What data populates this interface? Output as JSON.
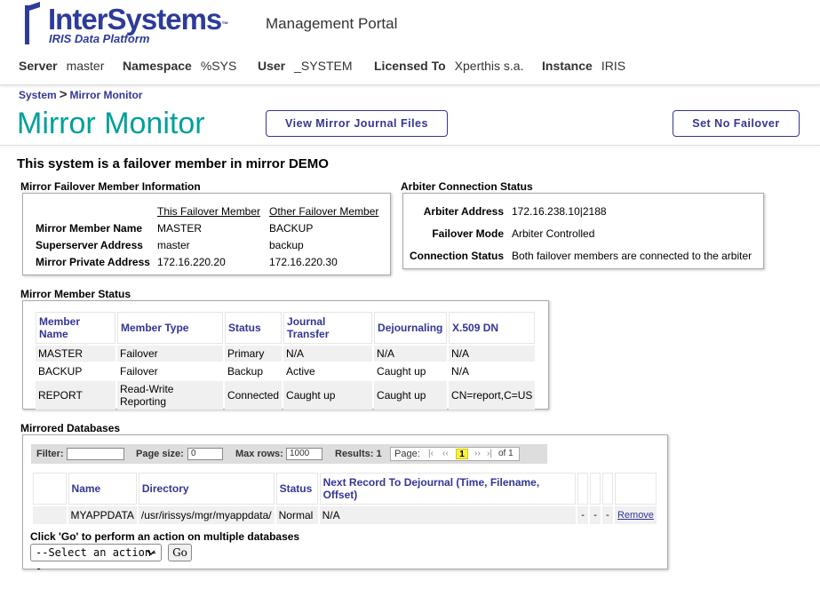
{
  "header": {
    "logo": {
      "brand": "InterSystems",
      "tm": "™",
      "product": "IRIS Data Platform"
    },
    "portal_title": "Management Portal",
    "context": {
      "server_label": "Server",
      "server": "master",
      "namespace_label": "Namespace",
      "namespace": "%SYS",
      "user_label": "User",
      "user": "_SYSTEM",
      "licensed_label": "Licensed To",
      "licensed": "Xperthis s.a.",
      "instance_label": "Instance",
      "instance": "IRIS"
    }
  },
  "breadcrumb": {
    "root": "System",
    "sep": ">",
    "current": "Mirror Monitor"
  },
  "page_title": "Mirror Monitor",
  "buttons": {
    "journal": "View Mirror Journal Files",
    "failover": "Set No Failover"
  },
  "headline": "This system is a failover member in mirror DEMO",
  "member_info": {
    "section": "Mirror Failover Member Information",
    "col_this": "This Failover Member",
    "col_other": "Other Failover Member",
    "rows": [
      {
        "label": "Mirror Member Name",
        "this": "MASTER",
        "other": "BACKUP"
      },
      {
        "label": "Superserver Address",
        "this": "master",
        "other": "backup"
      },
      {
        "label": "Mirror Private Address",
        "this": "172.16.220.20",
        "other": "172.16.220.30"
      }
    ]
  },
  "arbiter": {
    "section": "Arbiter Connection Status",
    "rows": [
      {
        "label": "Arbiter Address",
        "value": "172.16.238.10|2188"
      },
      {
        "label": "Failover Mode",
        "value": "Arbiter Controlled"
      },
      {
        "label": "Connection Status",
        "value": "Both failover members are connected to the arbiter"
      }
    ]
  },
  "member_status": {
    "section": "Mirror Member Status",
    "columns": [
      "Member Name",
      "Member Type",
      "Status",
      "Journal Transfer",
      "Dejournaling",
      "X.509 DN"
    ],
    "rows": [
      [
        "MASTER",
        "Failover",
        "Primary",
        "N/A",
        "N/A",
        "N/A"
      ],
      [
        "BACKUP",
        "Failover",
        "Backup",
        "Active",
        "Caught up",
        "N/A"
      ],
      [
        "REPORT",
        "Read-Write Reporting",
        "Connected",
        "Caught up",
        "Caught up",
        "CN=report,C=US"
      ]
    ]
  },
  "mirrored_db": {
    "section": "Mirrored Databases",
    "filter_label": "Filter:",
    "filter_value": "",
    "page_size_label": "Page size:",
    "page_size": "0",
    "max_rows_label": "Max rows:",
    "max_rows": "1000",
    "results_label": "Results: 1",
    "page_label": "Page:",
    "pager": {
      "first": "|‹",
      "prev": "‹‹",
      "current": "1",
      "next": "››",
      "last": "›|",
      "of": "of 1"
    },
    "columns": [
      "Name",
      "Directory",
      "Status",
      "Next Record To Dejournal (Time, Filename, Offset)"
    ],
    "rows": [
      {
        "name": "MYAPPDATA",
        "directory": "/usr/irissys/mgr/myappdata/",
        "status": "Normal",
        "next": "N/A",
        "c1": "-",
        "c2": "-",
        "c3": "-",
        "remove": "Remove"
      }
    ],
    "action_note": "Click 'Go' to perform an action on multiple databases",
    "action_select": "--Select an action--",
    "go": "Go"
  }
}
